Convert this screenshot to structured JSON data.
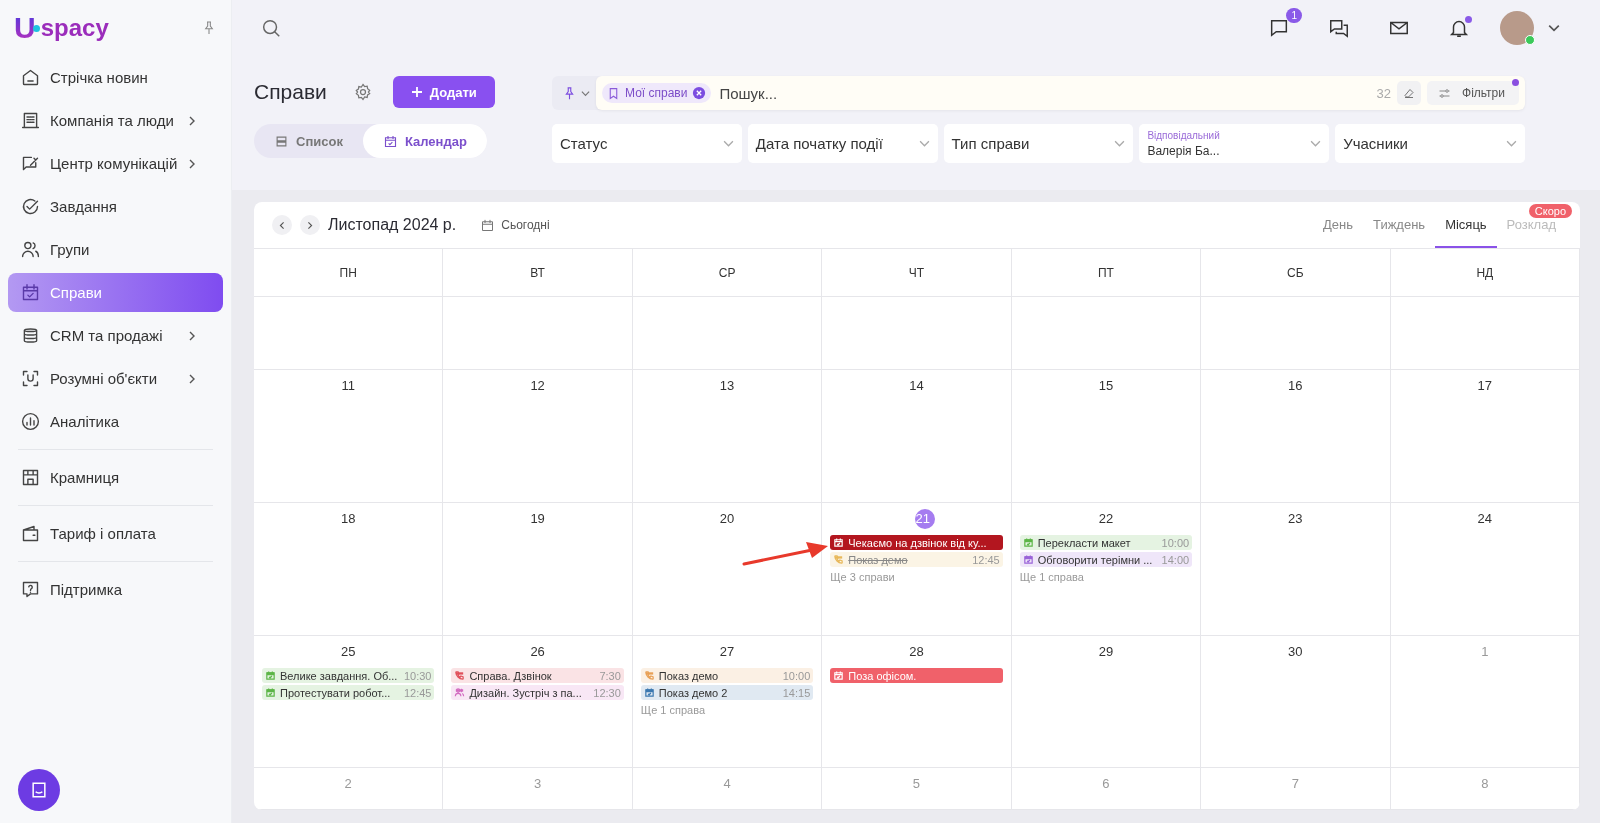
{
  "sidebar": {
    "logo": {
      "mark": "U",
      "text": "spacy"
    },
    "groups": [
      [
        {
          "label": "Стрічка новин",
          "kind": "home",
          "has_submenu": false,
          "selected": false
        },
        {
          "label": "Компанія та люди",
          "kind": "building",
          "has_submenu": true,
          "selected": false
        },
        {
          "label": "Центр комунікацій",
          "kind": "chat",
          "has_submenu": true,
          "selected": false
        },
        {
          "label": "Завдання",
          "kind": "check",
          "has_submenu": false,
          "selected": false
        },
        {
          "label": "Групи",
          "kind": "users",
          "has_submenu": false,
          "selected": false
        },
        {
          "label": "Справи",
          "kind": "calendar",
          "has_submenu": false,
          "selected": true
        },
        {
          "label": "CRM та продажі",
          "kind": "database",
          "has_submenu": true,
          "selected": false
        },
        {
          "label": "Розумні об'єкти",
          "kind": "scan",
          "has_submenu": true,
          "selected": false
        },
        {
          "label": "Аналітика",
          "kind": "chart",
          "has_submenu": false,
          "selected": false
        }
      ],
      [
        {
          "label": "Крамниця",
          "kind": "store",
          "has_submenu": false,
          "selected": false
        }
      ],
      [
        {
          "label": "Тариф і оплата",
          "kind": "wallet",
          "has_submenu": false,
          "selected": false
        }
      ],
      [
        {
          "label": "Підтримка",
          "kind": "help",
          "has_submenu": false,
          "selected": false
        }
      ]
    ]
  },
  "topbar": {
    "chat_badge": "1",
    "notifications_unread": true
  },
  "page": {
    "title": "Справи",
    "add_button": "Додати",
    "views": [
      {
        "label": "Список",
        "kind": "list",
        "selected": false
      },
      {
        "label": "Календар",
        "kind": "calendar",
        "selected": true
      }
    ],
    "search": {
      "chip": "Мої справи",
      "placeholder": "Пошук...",
      "count": "32",
      "filters_button": "Фільтри",
      "filters_active": true
    },
    "filters": [
      {
        "label": "Статус"
      },
      {
        "label": "Дата початку події"
      },
      {
        "label": "Тип справи"
      },
      {
        "label": "Відповідальний",
        "value": "Валерія Ба..."
      },
      {
        "label": "Учасники"
      }
    ]
  },
  "calendar": {
    "month": "Листопад 2024 р.",
    "today_button": "Сьогодні",
    "views": [
      {
        "label": "День",
        "selected": false,
        "disabled": false
      },
      {
        "label": "Тиждень",
        "selected": false,
        "disabled": false
      },
      {
        "label": "Місяць",
        "selected": true,
        "disabled": false
      },
      {
        "label": "Розклад",
        "selected": false,
        "disabled": true,
        "badge": "Скоро"
      }
    ],
    "weekdays": [
      "ПН",
      "ВТ",
      "СР",
      "ЧТ",
      "ПТ",
      "СБ",
      "НД"
    ],
    "weeks": [
      {
        "days": [
          {
            "number": "11",
            "today": false,
            "other_month": false
          },
          {
            "number": "12",
            "today": false,
            "other_month": false
          },
          {
            "number": "13",
            "today": false,
            "other_month": false
          },
          {
            "number": "14",
            "today": false,
            "other_month": false
          },
          {
            "number": "15",
            "today": false,
            "other_month": false
          },
          {
            "number": "16",
            "today": false,
            "other_month": false
          },
          {
            "number": "17",
            "today": false,
            "other_month": false
          }
        ]
      },
      {
        "days": [
          {
            "number": "18",
            "today": false,
            "other_month": false
          },
          {
            "number": "19",
            "today": false,
            "other_month": false
          },
          {
            "number": "20",
            "today": false,
            "other_month": false
          },
          {
            "number": "21",
            "today": true,
            "other_month": false,
            "events": [
              {
                "title": "Чекаємо на дзвінок від ку...",
                "color": "#b3161f",
                "solid": true,
                "done": false,
                "kind": "calendar"
              },
              {
                "title": "Показ демо",
                "time": "12:45",
                "color": "#e8b85a",
                "solid": false,
                "done": true,
                "kind": "phone"
              }
            ],
            "more": "Ще 3 справи"
          },
          {
            "number": "22",
            "today": false,
            "other_month": false,
            "events": [
              {
                "title": "Перекласти макет",
                "time": "10:00",
                "color": "#5cb547",
                "solid": false,
                "done": false,
                "kind": "calendar"
              },
              {
                "title": "Обговорити терімни ...",
                "time": "14:00",
                "color": "#9a63d8",
                "solid": false,
                "done": false,
                "kind": "calendar"
              }
            ],
            "more": "Ще 1 справа"
          },
          {
            "number": "23",
            "today": false,
            "other_month": false
          },
          {
            "number": "24",
            "today": false,
            "other_month": false
          }
        ]
      },
      {
        "days": [
          {
            "number": "25",
            "today": false,
            "other_month": false,
            "events": [
              {
                "title": "Велике завдання. Об...",
                "time": "10:30",
                "color": "#5cb547",
                "solid": false,
                "done": false,
                "kind": "calendar"
              },
              {
                "title": "Протестувати робот...",
                "time": "12:45",
                "color": "#5cb547",
                "solid": false,
                "done": false,
                "kind": "calendar"
              }
            ]
          },
          {
            "number": "26",
            "today": false,
            "other_month": false,
            "events": [
              {
                "title": "Справа. Дзвінок",
                "time": "7:30",
                "color": "#e0505a",
                "solid": false,
                "done": false,
                "kind": "phone"
              },
              {
                "title": "Дизайн. Зустріч з па...",
                "time": "12:30",
                "color": "#d26bc0",
                "solid": false,
                "done": false,
                "kind": "people"
              }
            ]
          },
          {
            "number": "27",
            "today": false,
            "other_month": false,
            "events": [
              {
                "title": "Показ демо",
                "time": "10:00",
                "color": "#e8a056",
                "solid": false,
                "done": false,
                "kind": "phone"
              },
              {
                "title": "Показ демо 2",
                "time": "14:15",
                "color": "#3b78b0",
                "solid": false,
                "done": false,
                "kind": "calendar"
              }
            ],
            "more": "Ще 1 справа"
          },
          {
            "number": "28",
            "today": false,
            "other_month": false,
            "events": [
              {
                "title": "Поза офісом.",
                "color": "#f0616a",
                "solid": true,
                "done": false,
                "kind": "calendar"
              }
            ]
          },
          {
            "number": "29",
            "today": false,
            "other_month": false
          },
          {
            "number": "30",
            "today": false,
            "other_month": false
          },
          {
            "number": "1",
            "today": false,
            "other_month": true
          }
        ]
      },
      {
        "days": [
          {
            "number": "2",
            "today": false,
            "other_month": true
          },
          {
            "number": "3",
            "today": false,
            "other_month": true
          },
          {
            "number": "4",
            "today": false,
            "other_month": true
          },
          {
            "number": "5",
            "today": false,
            "other_month": true
          },
          {
            "number": "6",
            "today": false,
            "other_month": true
          },
          {
            "number": "7",
            "today": false,
            "other_month": true
          },
          {
            "number": "8",
            "today": false,
            "other_month": true
          }
        ]
      }
    ]
  }
}
